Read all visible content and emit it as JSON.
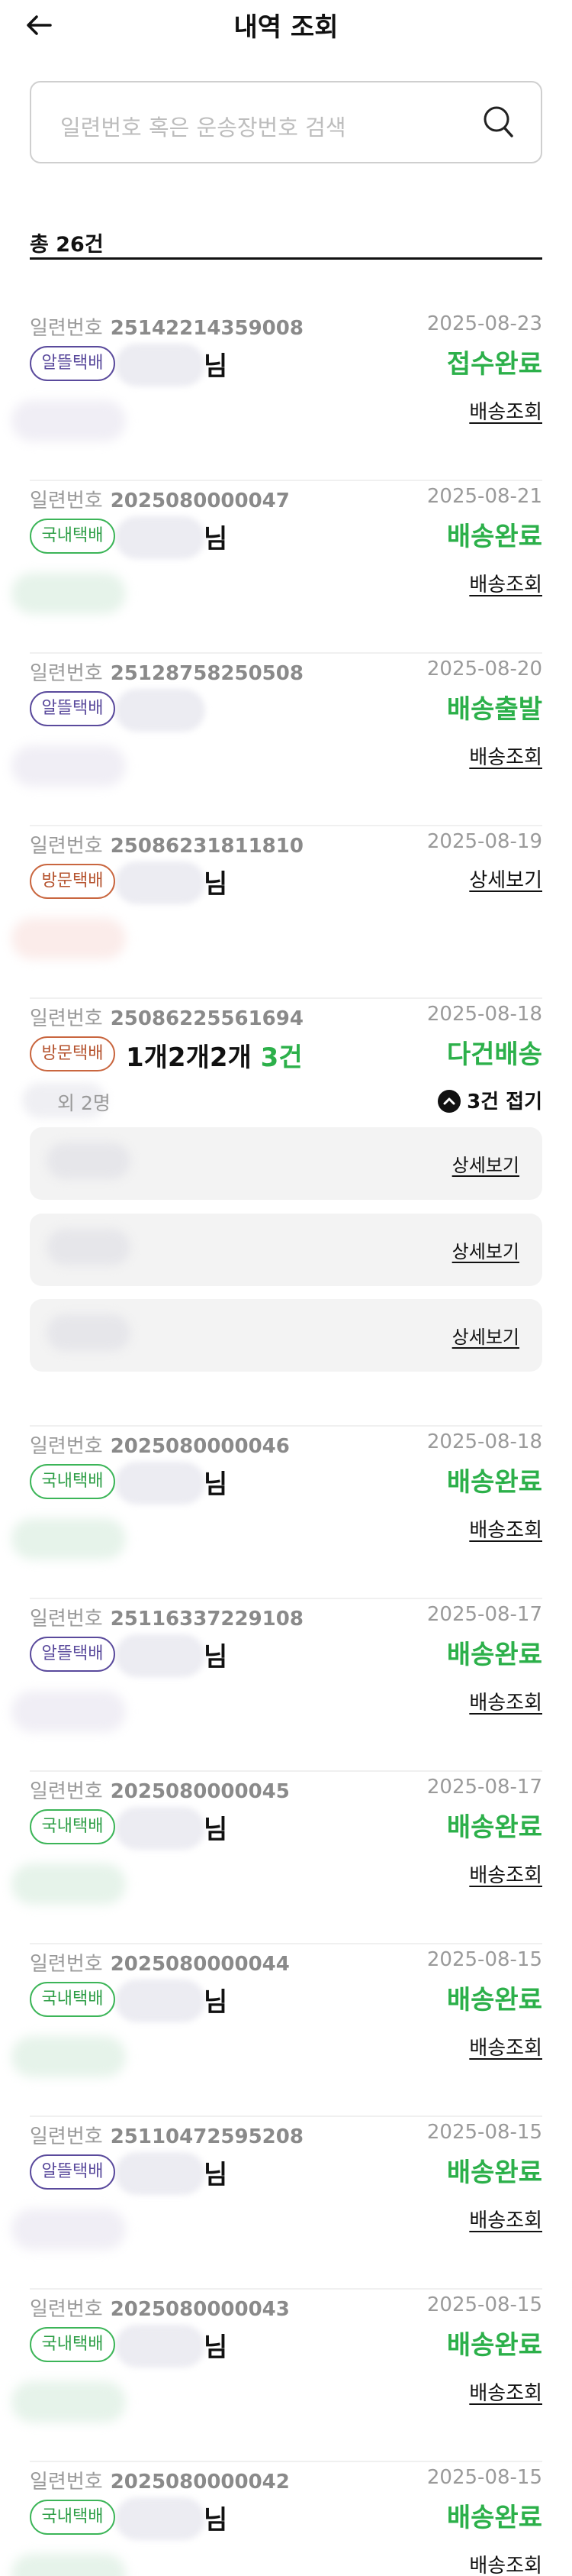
{
  "header": {
    "title": "내역 조회"
  },
  "search": {
    "placeholder": "일련번호 혹은 운송장번호 검색"
  },
  "summary": {
    "total": "총 26건"
  },
  "labels": {
    "serial": "일련번호",
    "name_suffix": "님",
    "track": "배송조회",
    "detail": "상세보기"
  },
  "items": [
    {
      "serial": "25142214359008",
      "date": "2025-08-23",
      "badge": "알뜰택배",
      "status": "접수완료",
      "link": "배송조회"
    },
    {
      "serial": "2025080000047",
      "date": "2025-08-21",
      "badge": "국내택배",
      "status": "배송완료",
      "link": "배송조회"
    },
    {
      "serial": "25128758250508",
      "date": "2025-08-20",
      "badge": "알뜰택배",
      "status": "배송출발",
      "link": "배송조회"
    },
    {
      "serial": "25086231811810",
      "date": "2025-08-19",
      "badge": "방문택배",
      "link": "상세보기"
    },
    {
      "serial": "25086225561694",
      "date": "2025-08-18",
      "badge": "방문택배",
      "title": "1개2개2개",
      "count": "3건",
      "status": "다건배송",
      "receivers": "외 2명",
      "fold": "3건 접기",
      "subs": [
        {
          "link": "상세보기"
        },
        {
          "link": "상세보기"
        },
        {
          "link": "상세보기"
        }
      ]
    },
    {
      "serial": "2025080000046",
      "date": "2025-08-18",
      "badge": "국내택배",
      "status": "배송완료",
      "link": "배송조회"
    },
    {
      "serial": "25116337229108",
      "date": "2025-08-17",
      "badge": "알뜰택배",
      "status": "배송완료",
      "link": "배송조회"
    },
    {
      "serial": "2025080000045",
      "date": "2025-08-17",
      "badge": "국내택배",
      "status": "배송완료",
      "link": "배송조회"
    },
    {
      "serial": "2025080000044",
      "date": "2025-08-15",
      "badge": "국내택배",
      "status": "배송완료",
      "link": "배송조회"
    },
    {
      "serial": "25110472595208",
      "date": "2025-08-15",
      "badge": "알뜰택배",
      "status": "배송완료",
      "link": "배송조회"
    },
    {
      "serial": "2025080000043",
      "date": "2025-08-15",
      "badge": "국내택배",
      "status": "배송완료",
      "link": "배송조회"
    },
    {
      "serial": "2025080000042",
      "date": "2025-08-15",
      "badge": "국내택배",
      "status": "배송완료",
      "link": "배송조회"
    }
  ],
  "colors": {
    "green": "#2cb04a",
    "purple": "#5a4a9c",
    "orange": "#c9663f",
    "gray": "#9a9a9a"
  },
  "icons": {
    "back": "arrow-left-icon",
    "search": "search-icon",
    "fold": "chevron-up-circle-icon"
  }
}
